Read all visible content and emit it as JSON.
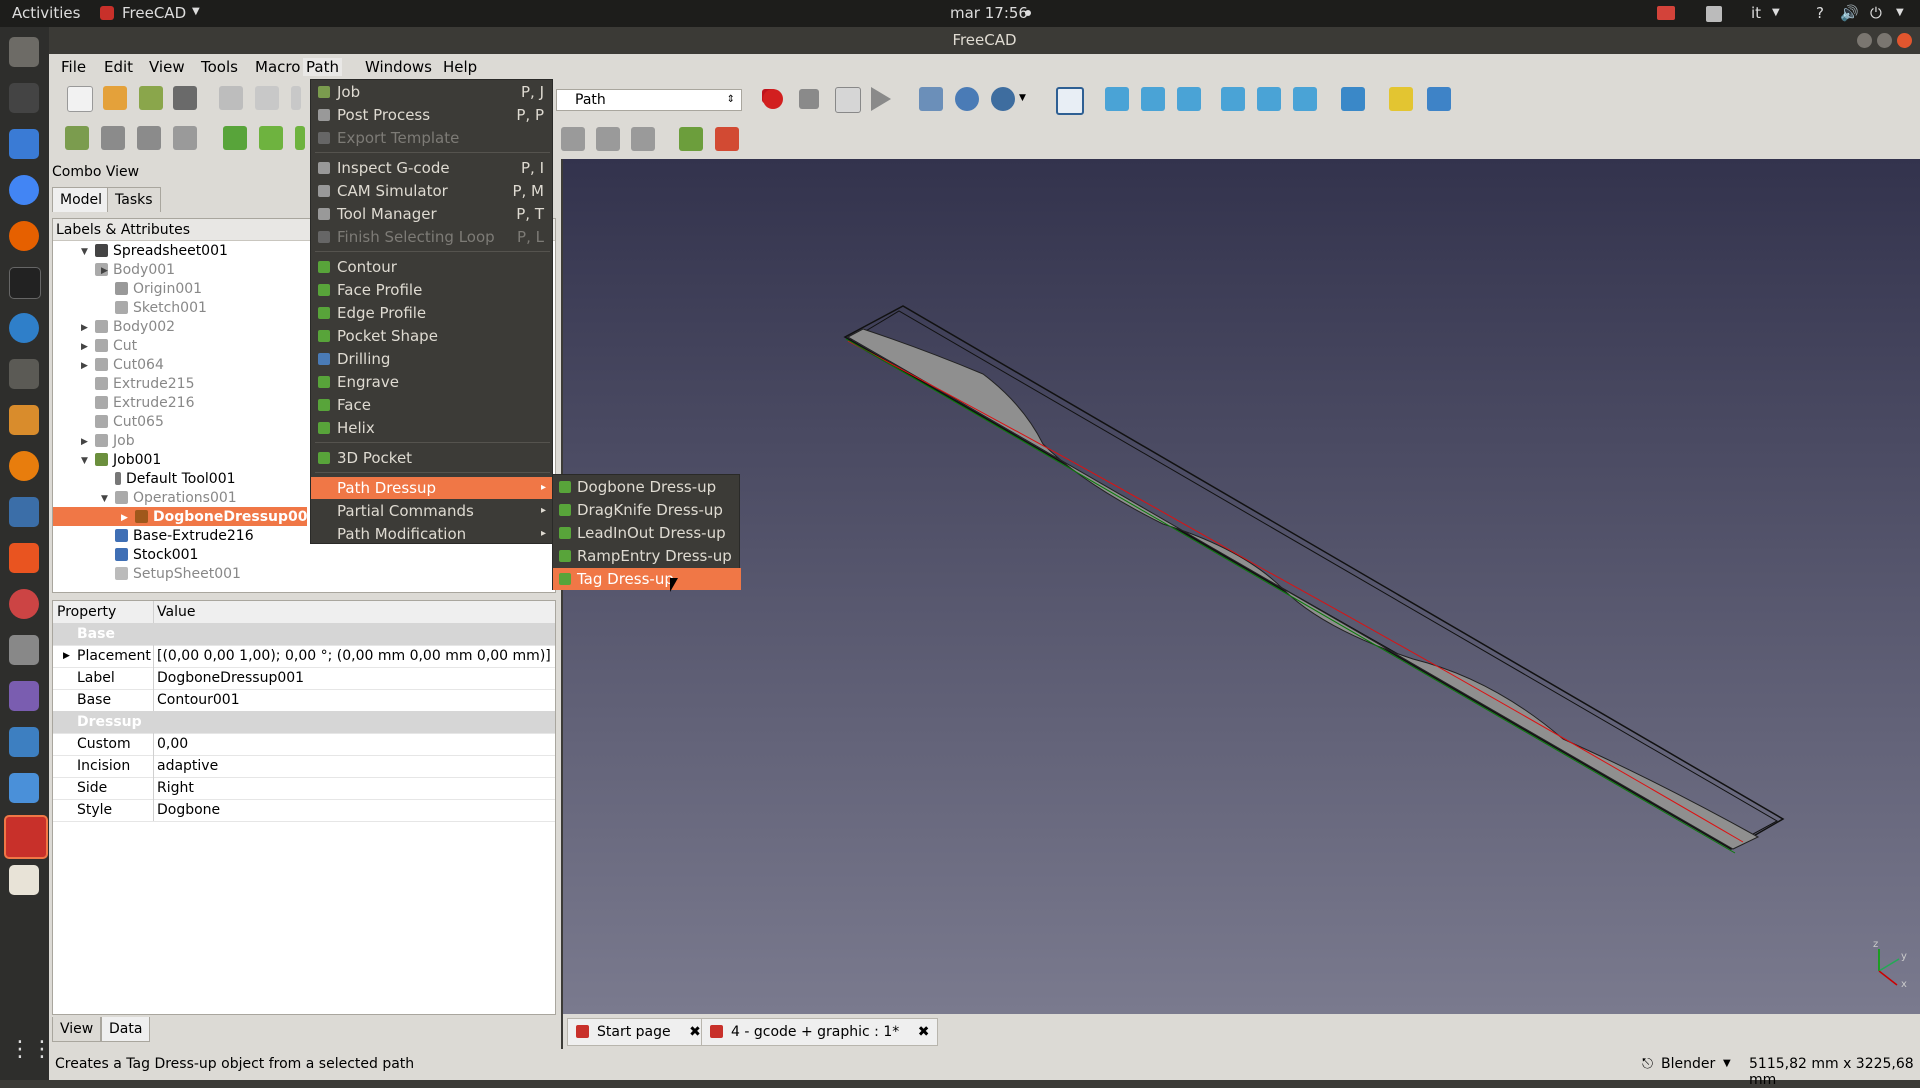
{
  "topbar": {
    "activities": "Activities",
    "app_name": "FreeCAD",
    "clock": "mar 17:56",
    "lang": "it"
  },
  "window": {
    "title": "FreeCAD"
  },
  "menubar": [
    "File",
    "Edit",
    "View",
    "Tools",
    "Macro",
    "Path",
    "Windows",
    "Help"
  ],
  "workbench": {
    "selected": "Path"
  },
  "combo": {
    "title": "Combo View",
    "tabs": [
      "Model",
      "Tasks"
    ],
    "tree_header": "Labels & Attributes",
    "tree": [
      "Spreadsheet001",
      "Body001",
      "Origin001",
      "Sketch001",
      "Body002",
      "Cut",
      "Cut064",
      "Extrude215",
      "Extrude216",
      "Cut065",
      "Job",
      "Job001",
      "Default Tool001",
      "Operations001",
      "DogboneDressup001",
      "Base-Extrude216",
      "Stock001",
      "SetupSheet001"
    ],
    "props_header": {
      "name": "Property",
      "value": "Value"
    },
    "props": [
      {
        "group": "Base"
      },
      {
        "name": "Placement",
        "value": "[(0,00 0,00 1,00); 0,00 °; (0,00 mm  0,00 mm  0,00 mm)]"
      },
      {
        "name": "Label",
        "value": "DogboneDressup001"
      },
      {
        "name": "Base",
        "value": "Contour001"
      },
      {
        "group": "Dressup"
      },
      {
        "name": "Custom",
        "value": "0,00"
      },
      {
        "name": "Incision",
        "value": "adaptive"
      },
      {
        "name": "Side",
        "value": "Right"
      },
      {
        "name": "Style",
        "value": "Dogbone"
      }
    ],
    "bottom_tabs": [
      "View",
      "Data"
    ]
  },
  "path_menu": [
    {
      "label": "Job",
      "shortcut": "P, J"
    },
    {
      "label": "Post Process",
      "shortcut": "P, P"
    },
    {
      "label": "Export Template",
      "shortcut": ""
    },
    {
      "label": "Inspect G-code",
      "shortcut": "P, I"
    },
    {
      "label": "CAM Simulator",
      "shortcut": "P, M"
    },
    {
      "label": "Tool Manager",
      "shortcut": "P, T"
    },
    {
      "label": "Finish Selecting Loop",
      "shortcut": "P, L"
    },
    {
      "label": "Contour",
      "shortcut": ""
    },
    {
      "label": "Face Profile",
      "shortcut": ""
    },
    {
      "label": "Edge Profile",
      "shortcut": ""
    },
    {
      "label": "Pocket Shape",
      "shortcut": ""
    },
    {
      "label": "Drilling",
      "shortcut": ""
    },
    {
      "label": "Engrave",
      "shortcut": ""
    },
    {
      "label": "Face",
      "shortcut": ""
    },
    {
      "label": "Helix",
      "shortcut": ""
    },
    {
      "label": "3D Pocket",
      "shortcut": ""
    },
    {
      "label": "Path Dressup",
      "shortcut": ""
    },
    {
      "label": "Partial Commands",
      "shortcut": ""
    },
    {
      "label": "Path Modification",
      "shortcut": ""
    }
  ],
  "dressup_menu": [
    "Dogbone Dress-up",
    "DragKnife Dress-up",
    "LeadInOut Dress-up",
    "RampEntry Dress-up",
    "Tag Dress-up"
  ],
  "doc_tabs": [
    "Start page",
    "4 - gcode + graphic : 1*"
  ],
  "status": {
    "message": "Creates a Tag Dress-up object from a selected path",
    "nav_style": "Blender",
    "dimensions": "5115,82 mm x 3225,68 mm"
  },
  "colors": {
    "accent": "#f07746",
    "menu_bg": "#3c3b37"
  }
}
